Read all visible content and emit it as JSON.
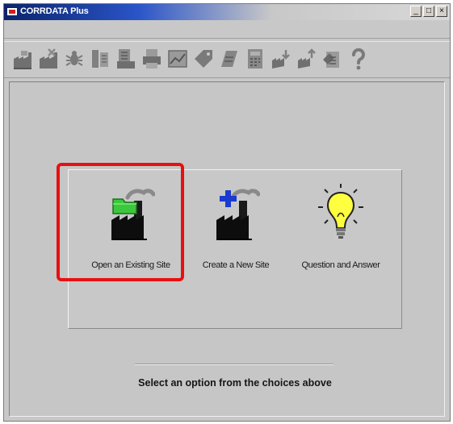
{
  "window": {
    "title": "CORRDATA Plus",
    "controls": [
      "_",
      "□",
      "×"
    ]
  },
  "toolbar": {
    "icons": [
      "open-site-icon",
      "close-site-icon",
      "bug-icon",
      "inspection-icon",
      "report-icon",
      "printer-icon",
      "chart-icon",
      "tag-icon",
      "wave-icon",
      "calculator-icon",
      "download-icon",
      "upload-icon",
      "properties-icon",
      "help-icon"
    ]
  },
  "options": [
    {
      "label": "Open an Existing Site",
      "icon": "factory-folder-icon"
    },
    {
      "label": "Create a New Site",
      "icon": "factory-plus-icon"
    },
    {
      "label": "Question and Answer",
      "icon": "lightbulb-icon"
    }
  ],
  "prompt": "Select an option from the choices above",
  "colors": {
    "title_bar": "#0a246a",
    "highlight": "#e81010",
    "folder": "#3cc83c",
    "plus": "#1a3ad0",
    "bulb": "#ffff40"
  }
}
